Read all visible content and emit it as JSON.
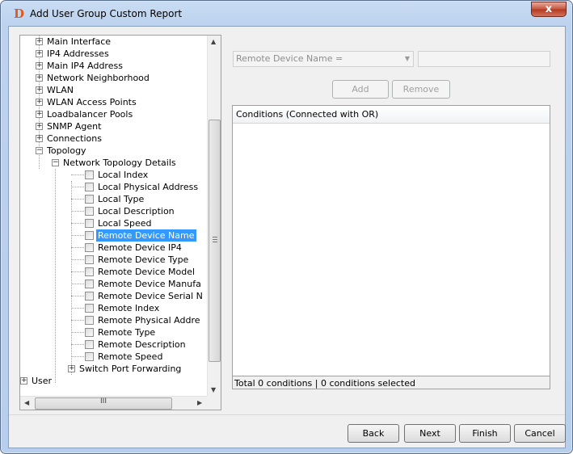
{
  "window": {
    "title": "Add User Group Custom Report",
    "app_icon": "D",
    "close_label": "x"
  },
  "tree": {
    "nodes": [
      {
        "label": "Main Interface",
        "expander": "+"
      },
      {
        "label": "IP4 Addresses",
        "expander": "+"
      },
      {
        "label": "Main IP4 Address",
        "expander": "+"
      },
      {
        "label": "Network Neighborhood",
        "expander": "+"
      },
      {
        "label": "WLAN",
        "expander": "+"
      },
      {
        "label": "WLAN Access Points",
        "expander": "+"
      },
      {
        "label": "Loadbalancer Pools",
        "expander": "+"
      },
      {
        "label": "SNMP Agent",
        "expander": "+"
      },
      {
        "label": "Connections",
        "expander": "+"
      },
      {
        "label": "Topology",
        "expander": "−"
      },
      {
        "label": "Network Topology Details",
        "expander": "−"
      },
      {
        "label": "Local Index"
      },
      {
        "label": "Local Physical Address"
      },
      {
        "label": "Local Type"
      },
      {
        "label": "Local Description"
      },
      {
        "label": "Local Speed"
      },
      {
        "label": "Remote Device Name"
      },
      {
        "label": "Remote Device IP4"
      },
      {
        "label": "Remote Device Type"
      },
      {
        "label": "Remote Device Model"
      },
      {
        "label": "Remote Device Manufa"
      },
      {
        "label": "Remote Device Serial N"
      },
      {
        "label": "Remote Index"
      },
      {
        "label": "Remote Physical Addre"
      },
      {
        "label": "Remote Type"
      },
      {
        "label": "Remote Description"
      },
      {
        "label": "Remote Speed"
      },
      {
        "label": "Switch Port Forwarding",
        "expander": "+"
      },
      {
        "label": "User",
        "expander": "+"
      }
    ],
    "selected": "Remote Device Name",
    "hscroll_grip": "III"
  },
  "filter": {
    "field_value": "Remote Device Name =",
    "add_label": "Add",
    "remove_label": "Remove"
  },
  "conditions": {
    "header": "Conditions (Connected with OR)",
    "status": "Total 0 conditions | 0 conditions selected"
  },
  "footer": {
    "back_label": "Back",
    "next_label": "Next",
    "finish_label": "Finish",
    "cancel_label": "Cancel"
  },
  "colors": {
    "selection": "#3399ff",
    "icon": "#e0591b"
  }
}
